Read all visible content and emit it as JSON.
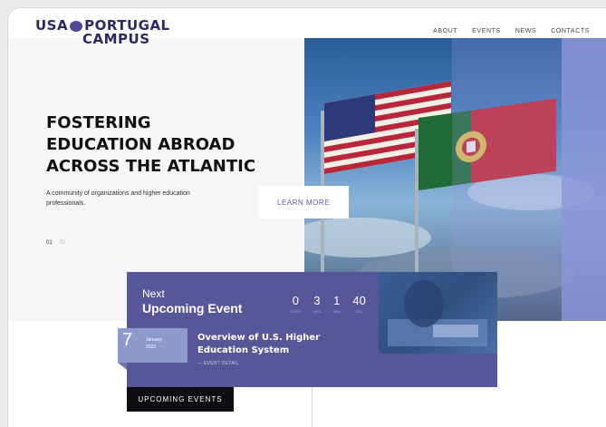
{
  "logo": {
    "line1_left": "USA",
    "line1_right": "PORTUGAL",
    "line2": "CAMPUS"
  },
  "nav": {
    "items": [
      "ABOUT",
      "EVENTS",
      "NEWS",
      "CONTACTS"
    ]
  },
  "hero": {
    "headline_lines": [
      "FOSTERING",
      "EDUCATION ABROAD",
      "ACROSS THE ATLANTIC"
    ],
    "subtext": "A community of organizations and higher education professionals.",
    "slide_current": "01",
    "slide_next": "02",
    "cta_label": "LEARN MORE"
  },
  "event": {
    "kicker": "Next",
    "heading": "Upcoming Event",
    "countdown": [
      {
        "value": "0",
        "label": "DAYS"
      },
      {
        "value": "3",
        "label": "HRS"
      },
      {
        "value": "1",
        "label": "MIN"
      },
      {
        "value": "40",
        "label": "SEC"
      }
    ],
    "date_day": "7",
    "date_month": "January",
    "date_year": "2022",
    "title_lines": [
      "Overview of U.S. Higher",
      "Education System"
    ],
    "detail_link": "— EVENT DETAIL"
  },
  "upcoming_button": "UPCOMING EVENTS",
  "colors": {
    "brand_navy": "#2b2868",
    "event_purple": "#595599",
    "date_box": "#8e9acc"
  }
}
